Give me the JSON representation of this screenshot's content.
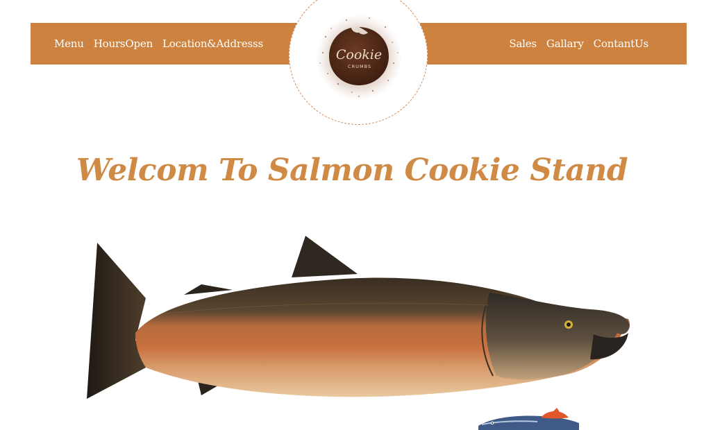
{
  "nav": {
    "left_items": [
      {
        "label": "Menu"
      },
      {
        "label": "HoursOpen"
      },
      {
        "label": "Location&Addresss"
      }
    ],
    "right_items": [
      {
        "label": "Sales"
      },
      {
        "label": "Gallary"
      },
      {
        "label": "ContantUs"
      }
    ]
  },
  "logo": {
    "title": "Cookie",
    "subtitle": "CRUMBS",
    "icon": "cookie-logo"
  },
  "hero": {
    "title": "Welcom To Salmon Cookie Stand"
  },
  "images": {
    "main": "salmon-illustration",
    "secondary": "small-fish-illustration"
  },
  "colors": {
    "accent": "#cd833f",
    "background": "#ffffff",
    "title": "#cf8a45",
    "nav_text": "#ffffff"
  }
}
